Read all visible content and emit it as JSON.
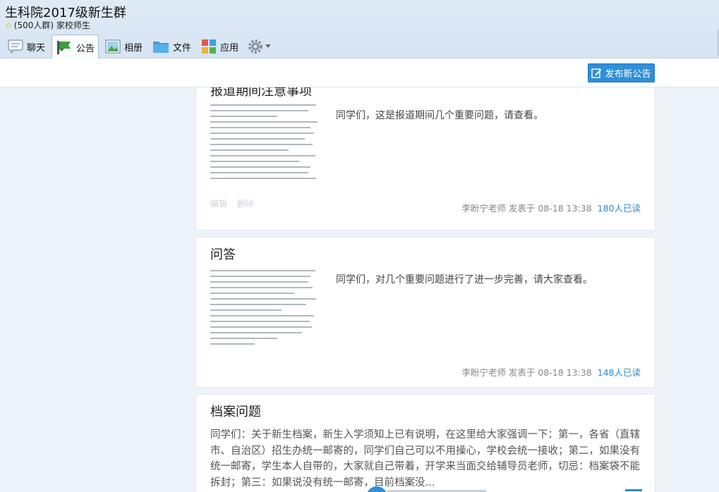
{
  "header": {
    "title": "生科院2017级新生群",
    "subtitle": "(500人群) 家校师生",
    "star_icon": "star-icon"
  },
  "tabs": [
    {
      "label": "聊天",
      "icon": "chat-icon"
    },
    {
      "label": "公告",
      "icon": "announcement-icon",
      "active": true
    },
    {
      "label": "相册",
      "icon": "album-icon"
    },
    {
      "label": "文件",
      "icon": "folder-icon"
    },
    {
      "label": "应用",
      "icon": "apps-icon"
    }
  ],
  "settings_icon": "gear-icon",
  "toolbar": {
    "publish_label": "发布新公告",
    "publish_icon": "edit-icon"
  },
  "announcements": [
    {
      "title": "报道期间注意事项",
      "summary": "同学们，这是报道期间几个重要问题，请查看。",
      "author_time": "李盼宁老师 发表于 08-18 13:38",
      "reads": "180人已读",
      "edit_label": "编辑",
      "delete_label": "删除"
    },
    {
      "title": "问答",
      "summary": "同学们，对几个重要问题进行了进一步完善，请大家查看。",
      "author_time": "李盼宁老师 发表于 08-18 13:38",
      "reads": "148人已读"
    },
    {
      "title": "档案问题",
      "body": "同学们：关于新生档案，新生入学须知上已有说明，在这里给大家强调一下：第一，各省（直辖市、自治区）招生办统一邮寄的，同学们自己可以不用操心，学校会统一接收；第二，如果没有统一邮寄，学生本人自带的，大家就自己带着，开学来当面交给辅导员老师，切忌：档案袋不能拆封；第三：如果说没有统一邮寄，目前档案没..."
    }
  ],
  "colors": {
    "accent": "#2f8fd8",
    "read_count": "#2a8cd4",
    "header_bg": "#d6e4f3",
    "page_bg": "#eef3f9"
  }
}
